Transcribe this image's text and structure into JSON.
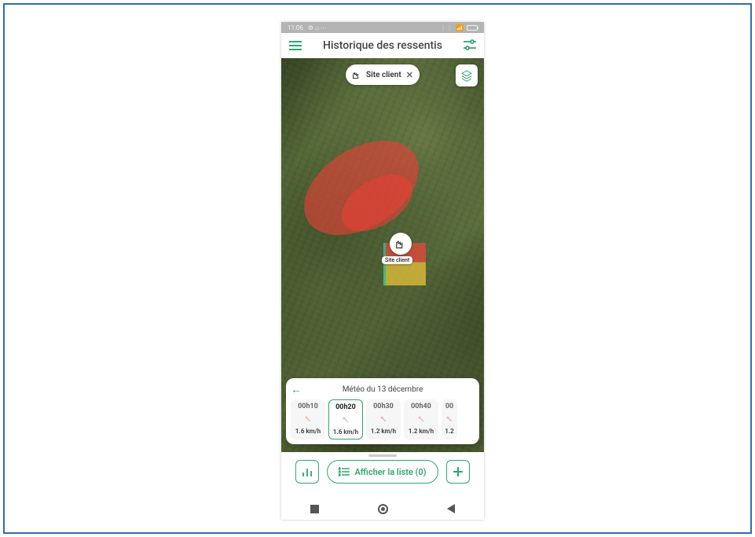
{
  "status": {
    "time": "11:06",
    "indicators": "⚙ ⌂ ⋯"
  },
  "appbar": {
    "title": "Historique des ressentis"
  },
  "map": {
    "chip_label": "Site client",
    "site_marker_label": "Site client"
  },
  "weather": {
    "title": "Météo du 13 décembre",
    "items": [
      {
        "time": "00h10",
        "speed": "1.6 km/h",
        "active": false
      },
      {
        "time": "00h20",
        "speed": "1.6 km/h",
        "active": true
      },
      {
        "time": "00h30",
        "speed": "1.2 km/h",
        "active": false
      },
      {
        "time": "00h40",
        "speed": "1.2 km/h",
        "active": false
      }
    ],
    "partial": {
      "time": "00",
      "speed": "1.2"
    }
  },
  "bottom": {
    "list_button": "Afficher la liste (0)"
  }
}
